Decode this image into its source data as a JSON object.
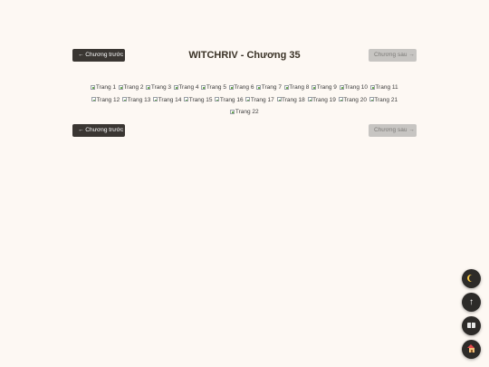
{
  "chapter": {
    "title": "WITCHRIV - Chương 35"
  },
  "nav": {
    "prev_label": "← Chương trước",
    "next_label": "Chương sau →"
  },
  "pages": [
    "Trang 1",
    "Trang 2",
    "Trang 3",
    "Trang 4",
    "Trang 5",
    "Trang 6",
    "Trang 7",
    "Trang 8",
    "Trang 9",
    "Trang 10",
    "Trang 11",
    "Trang 12",
    "Trang 13",
    "Trang 14",
    "Trang 15",
    "Trang 16",
    "Trang 17",
    "Trang 18",
    "Trang 19",
    "Trang 20",
    "Trang 21",
    "Trang 22"
  ],
  "floating_buttons": [
    {
      "name": "dark-mode-toggle",
      "icon": "moon-icon"
    },
    {
      "name": "scroll-top-button",
      "icon": "arrow-up-icon"
    },
    {
      "name": "chapter-list-button",
      "icon": "book-icon"
    },
    {
      "name": "home-button",
      "icon": "house-icon"
    }
  ],
  "colors": {
    "background": "#fdf8f3",
    "primary_button": "#3a3632",
    "disabled_button": "#c7c5c2",
    "fab": "#2d2b29"
  }
}
